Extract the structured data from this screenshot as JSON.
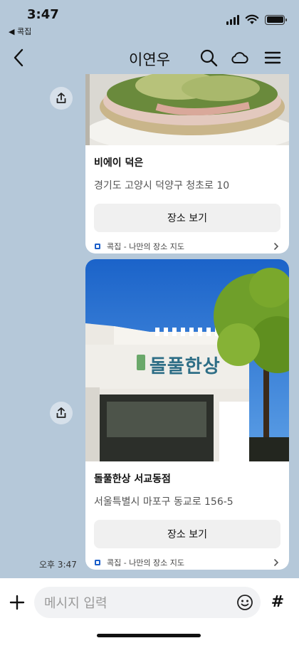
{
  "status": {
    "time": "3:47",
    "back_app": "◀ 콕집"
  },
  "nav": {
    "title": "이연우"
  },
  "cards": [
    {
      "name": "비에이 덕은",
      "address": "경기도 고양시 덕양구 청초로 10",
      "button_label": "장소 보기",
      "source": "콕집 - 나만의 장소 지도"
    },
    {
      "name": "돌풀한상 서교동점",
      "address": "서울특별시 마포구 동교로 156-5",
      "button_label": "장소 보기",
      "source": "콕집 - 나만의 장소 지도",
      "sign_text": "돌풀한상"
    }
  ],
  "message_time": "오후 3:47",
  "input": {
    "placeholder": "메시지 입력"
  },
  "colors": {
    "chat_bg": "#b5c8d9",
    "accent": "#1b5ec9"
  }
}
